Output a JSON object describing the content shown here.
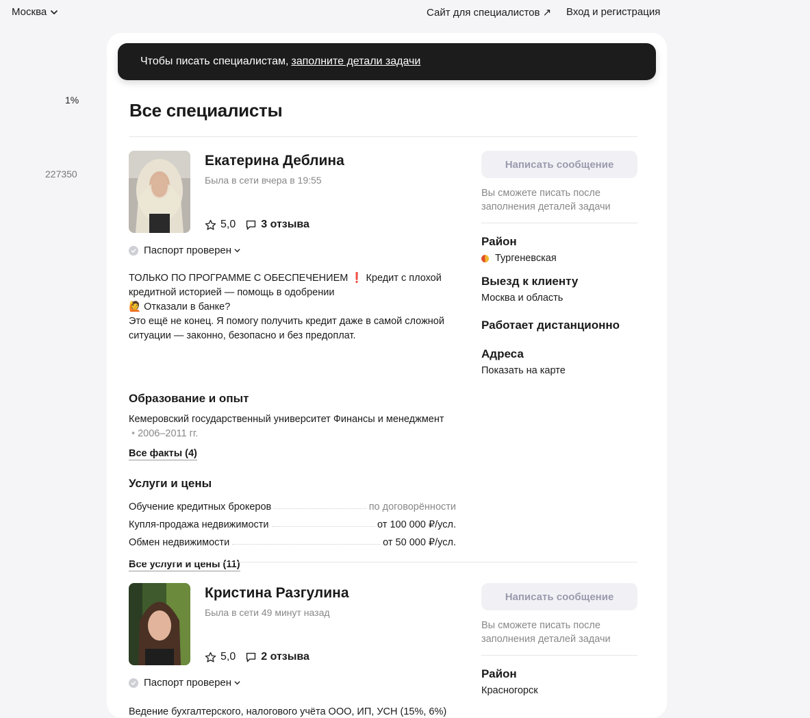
{
  "header": {
    "city": "Москва",
    "specialists_site": "Сайт для специалистов ↗",
    "login": "Вход и регистрация"
  },
  "side_numbers": {
    "percent": "1%",
    "count": "227350"
  },
  "banner": {
    "text": "Чтобы писать специалистам,",
    "link": "заполните детали задачи"
  },
  "page_title": "Все специалисты",
  "specialists": [
    {
      "name": "Екатерина Деблина",
      "online": "Была в сети вчера в 19:55",
      "rating": "5,0",
      "reviews": "3 отзыва",
      "passport": "Паспорт проверен",
      "description": {
        "line1_a": "ТОЛЬКО ПО ПРОГРАММЕ С ОБЕСПЕЧЕНИЕМ",
        "line1_mark": "❗",
        "line1_b": "Кредит с плохой кредитной историей — помощь в одобрении",
        "line2_icon": "🙋",
        "line2": "Отказали в банке?",
        "line3": "Это ещё не конец. Я помогу получить кредит даже в самой сложной ситуации — законно, безопасно и без предоплат."
      },
      "education_title": "Образование и опыт",
      "education": "Кемеровский государственный университет Финансы и менеджмент",
      "education_years": "2006–2011 гг.",
      "all_facts": "Все факты (4)",
      "services_title": "Услуги и цены",
      "services": [
        {
          "name": "Обучение кредитных брокеров",
          "price": "по договорённости"
        },
        {
          "name": "Купля-продажа недвижимости",
          "price": "от 100 000 ₽/усл."
        },
        {
          "name": "Обмен недвижимости",
          "price": "от 50 000 ₽/усл."
        }
      ],
      "all_services": "Все услуги и цены (11)",
      "message_button": "Написать сообщение",
      "message_hint": "Вы сможете писать после заполнения деталей задачи",
      "district_title": "Район",
      "district": "Тургеневская",
      "visit_title": "Выезд к клиенту",
      "visit": "Москва и область",
      "remote_title": "Работает дистанционно",
      "addresses_title": "Адреса",
      "addresses_link": "Показать на карте"
    },
    {
      "name": "Кристина Разгулина",
      "online": "Была в сети 49 минут назад",
      "rating": "5,0",
      "reviews": "2 отзыва",
      "passport": "Паспорт проверен",
      "description_start": "Ведение бухгалтерского, налогового учёта ООО, ИП, УСН (15%, 6%)",
      "message_button": "Написать сообщение",
      "message_hint": "Вы сможете писать после заполнения деталей задачи",
      "district_title": "Район",
      "district": "Красногорск"
    }
  ],
  "colors": {
    "banner_bg": "#1c1c1c",
    "button_bg": "#f1f1f5",
    "button_text": "#9a9aae",
    "muted": "#888888"
  }
}
